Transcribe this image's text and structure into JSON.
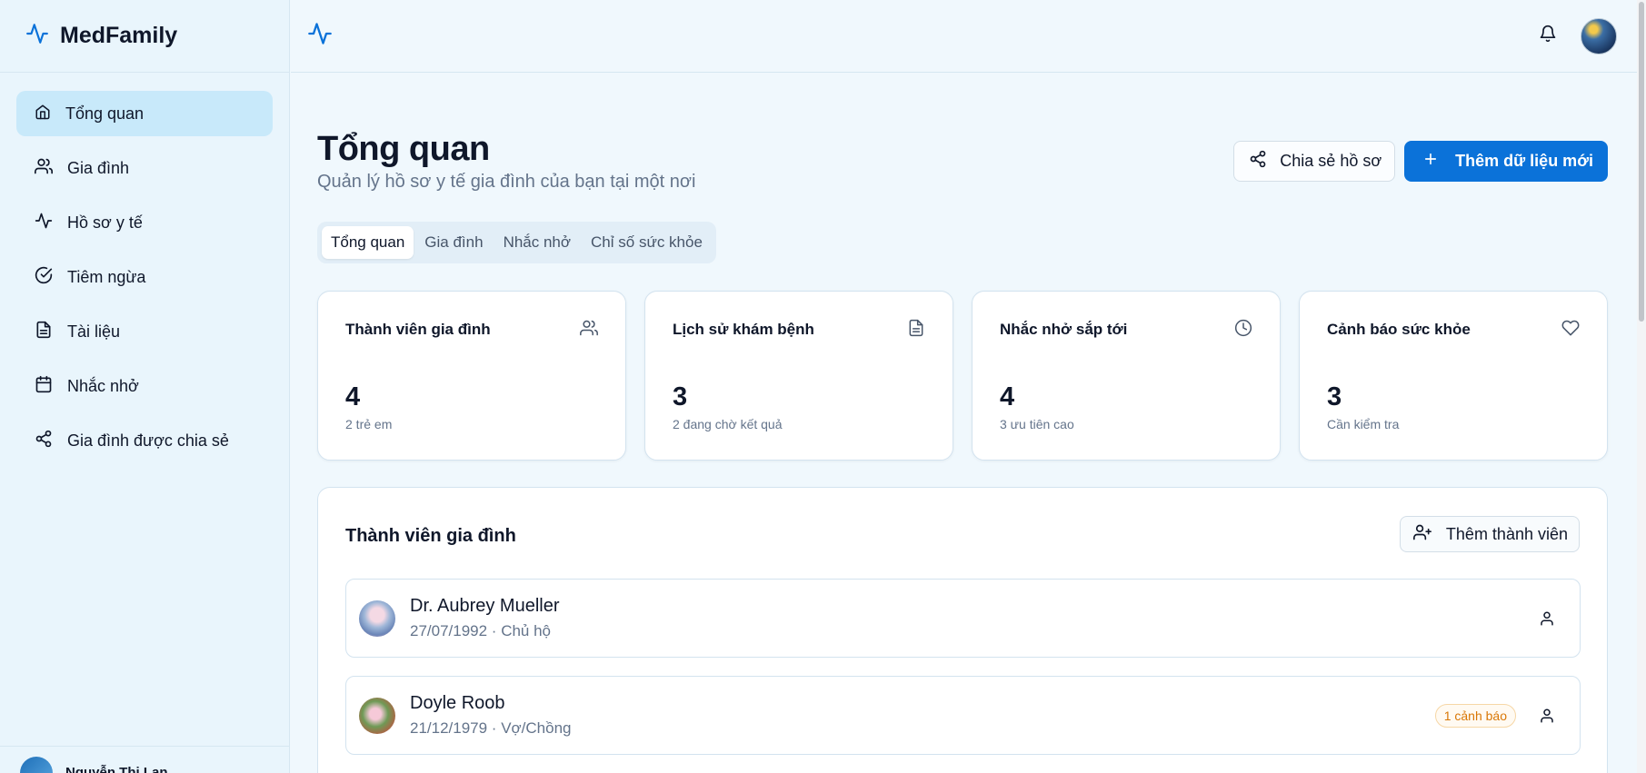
{
  "app": {
    "name": "MedFamily"
  },
  "sidebar": {
    "items": [
      {
        "label": "Tổng quan",
        "icon": "home-icon",
        "active": true
      },
      {
        "label": "Gia đình",
        "icon": "users-icon"
      },
      {
        "label": "Hồ sơ y tế",
        "icon": "activity-icon"
      },
      {
        "label": "Tiêm ngừa",
        "icon": "check-circle-icon"
      },
      {
        "label": "Tài liệu",
        "icon": "file-text-icon"
      },
      {
        "label": "Nhắc nhở",
        "icon": "calendar-icon"
      },
      {
        "label": "Gia đình được chia sẻ",
        "icon": "share-icon"
      }
    ],
    "user_name": "Nguyễn Thị Lan"
  },
  "header": {
    "title": "Tổng quan",
    "subtitle": "Quản lý hồ sơ y tế gia đình của bạn tại một nơi"
  },
  "actions": {
    "share_label": "Chia sẻ hồ sơ",
    "add_label": "Thêm dữ liệu mới"
  },
  "tabs": [
    {
      "label": "Tổng quan",
      "active": true
    },
    {
      "label": "Gia đình"
    },
    {
      "label": "Nhắc nhở"
    },
    {
      "label": "Chỉ số sức khỏe"
    }
  ],
  "stats": [
    {
      "title": "Thành viên gia đình",
      "value": "4",
      "note": "2 trẻ em",
      "icon": "users-icon"
    },
    {
      "title": "Lịch sử khám bệnh",
      "value": "3",
      "note": "2 đang chờ kết quả",
      "icon": "file-text-icon"
    },
    {
      "title": "Nhắc nhở sắp tới",
      "value": "4",
      "note": "3 ưu tiên cao",
      "icon": "clock-icon"
    },
    {
      "title": "Cảnh báo sức khỏe",
      "value": "3",
      "note": "Cần kiểm tra",
      "icon": "heart-icon"
    }
  ],
  "members": {
    "title": "Thành viên gia đình",
    "add_label": "Thêm thành viên",
    "rows": [
      {
        "name": "Dr. Aubrey Mueller",
        "meta": "27/07/1992 · Chủ hộ"
      },
      {
        "name": "Doyle Roob",
        "meta": "21/12/1979 · Vợ/Chồng",
        "badge": "1 cảnh báo"
      }
    ]
  },
  "colors": {
    "primary": "#0b72d9",
    "sidebar_bg": "#e9f5fc",
    "active_bg": "#c8e9fa",
    "warning": "#d97706"
  }
}
